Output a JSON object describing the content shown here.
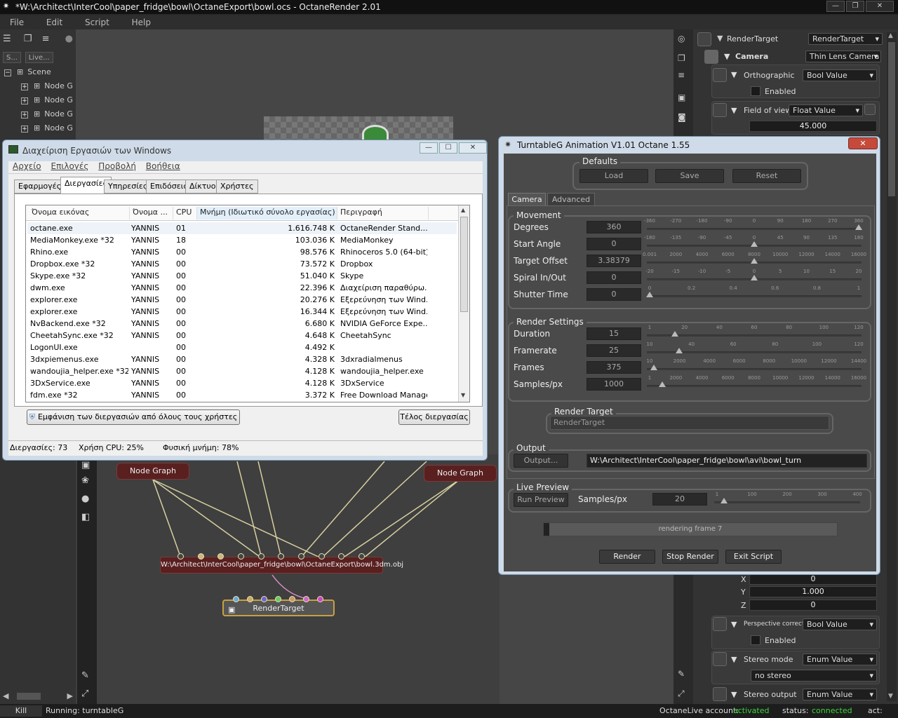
{
  "app": {
    "title": "*W:\\Architect\\InterCool\\paper_fridge\\bowl\\OctaneExport\\bowl.ocs - OctaneRender 2.01",
    "menu": [
      "File",
      "Edit",
      "Script",
      "Help"
    ]
  },
  "left": {
    "tabs": [
      "S...",
      "Live..."
    ],
    "scene_label": "Scene",
    "tree_items": [
      "Node G",
      "Node G",
      "Node G",
      "Node G"
    ]
  },
  "graph": {
    "node1": "Node Graph",
    "node2": "Node Graph",
    "obj_node": "W:\\Architect\\InterCool\\paper_fridge\\bowl\\OctaneExport\\bowl.3dm.obj",
    "rt_node": "RenderTarget"
  },
  "right": {
    "rendertarget_label": "RenderTarget",
    "rendertarget_dd": "RenderTarget",
    "camera_label": "Camera",
    "camera_dd": "Thin Lens Camera",
    "ortho_label": "Orthographic",
    "ortho_dd": "Bool Value",
    "ortho_enabled": "Enabled",
    "fov_label": "Field of view",
    "fov_dd": "Float Value",
    "fov_value": "45.000",
    "x_label": "X",
    "x_value": "0",
    "y_label": "Y",
    "y_value": "1.000",
    "z_label": "Z",
    "z_value": "0",
    "persp_label": "Perspective correction",
    "persp_dd": "Bool Value",
    "persp_enabled": "Enabled",
    "stereo_mode_label": "Stereo mode",
    "stereo_mode_dd": "Enum Value",
    "stereo_mode_value": "no stereo",
    "stereo_out_label": "Stereo output",
    "stereo_out_dd": "Enum Value"
  },
  "status": {
    "kill": "Kill",
    "running": "Running: turntableG",
    "live_label": "OctaneLive account:",
    "live_value": "activated",
    "status_label": "status:",
    "status_value": "connected",
    "act_label": "act:"
  },
  "taskmgr": {
    "title": "Διαχείριση Εργασιών των Windows",
    "menu": [
      "Αρχείο",
      "Επιλογές",
      "Προβολή",
      "Βοήθεια"
    ],
    "tabs": [
      "Εφαρμογές",
      "Διεργασίες",
      "Υπηρεσίες",
      "Επιδόσεις",
      "Δίκτυο",
      "Χρήστες"
    ],
    "columns": [
      "Όνομα εικόνας",
      "Όνομα ...",
      "CPU",
      "Μνήμη (Ιδιωτικό σύνολο εργασίας)",
      "Περιγραφή"
    ],
    "rows": [
      [
        "octane.exe",
        "YANNIS",
        "01",
        "1.616.748 K",
        "OctaneRender Stand..."
      ],
      [
        "MediaMonkey.exe *32",
        "YANNIS",
        "18",
        "103.036 K",
        "MediaMonkey"
      ],
      [
        "Rhino.exe",
        "YANNIS",
        "00",
        "98.576 K",
        "Rhinoceros 5.0 (64-bit)"
      ],
      [
        "Dropbox.exe *32",
        "YANNIS",
        "00",
        "73.572 K",
        "Dropbox"
      ],
      [
        "Skype.exe *32",
        "YANNIS",
        "00",
        "51.040 K",
        "Skype"
      ],
      [
        "dwm.exe",
        "YANNIS",
        "00",
        "22.396 K",
        "Διαχείριση παραθύρω..."
      ],
      [
        "explorer.exe",
        "YANNIS",
        "00",
        "20.276 K",
        "Εξερεύνηση των Wind..."
      ],
      [
        "explorer.exe",
        "YANNIS",
        "00",
        "16.344 K",
        "Εξερεύνηση των Wind..."
      ],
      [
        "NvBackend.exe *32",
        "YANNIS",
        "00",
        "6.680 K",
        "NVIDIA GeForce Expe..."
      ],
      [
        "CheetahSync.exe *32",
        "YANNIS",
        "00",
        "4.648 K",
        "CheetahSync"
      ],
      [
        "LogonUI.exe",
        "",
        "00",
        "4.492 K",
        ""
      ],
      [
        "3dxpiemenus.exe",
        "YANNIS",
        "00",
        "4.328 K",
        "3dxradialmenus"
      ],
      [
        "wandoujia_helper.exe *32",
        "YANNIS",
        "00",
        "4.128 K",
        "wandoujia_helper.exe"
      ],
      [
        "3DxService.exe",
        "YANNIS",
        "00",
        "4.128 K",
        "3DxService"
      ],
      [
        "fdm.exe *32",
        "YANNIS",
        "00",
        "3.372 K",
        "Free Download Manager"
      ]
    ],
    "show_all": "Εμφάνιση των διεργασιών από όλους τους χρήστες",
    "end_process": "Τέλος διεργασίας",
    "procs": "Διεργασίες: 73",
    "cpu": "Χρήση CPU: 25%",
    "mem": "Φυσική μνήμη: 78%"
  },
  "turntable": {
    "title": "TurntableG Animation V1.01 Octane 1.55",
    "defaults": "Defaults",
    "load": "Load",
    "save": "Save",
    "reset": "Reset",
    "tab_camera": "Camera",
    "tab_advanced": "Advanced",
    "movement": "Movement",
    "move_rows": [
      {
        "label": "Degrees",
        "value": "360",
        "ticks": [
          "-360",
          "-270",
          "-180",
          "-90",
          "0",
          "90",
          "180",
          "270",
          "360"
        ],
        "pos": 1.0
      },
      {
        "label": "Start Angle",
        "value": "0",
        "ticks": [
          "-180",
          "-135",
          "-90",
          "-45",
          "0",
          "45",
          "90",
          "135",
          "180"
        ],
        "pos": 0.5
      },
      {
        "label": "Target Offset",
        "value": "3.38379",
        "ticks": [
          "0.001",
          "2000",
          "4000",
          "6000",
          "8000",
          "10000",
          "12000",
          "14000",
          "16000"
        ],
        "pos": 0.5
      },
      {
        "label": "Spiral In/Out",
        "value": "0",
        "ticks": [
          "-20",
          "-15",
          "-10",
          "-5",
          "0",
          "5",
          "10",
          "15",
          "20"
        ],
        "pos": 0.5
      },
      {
        "label": "Shutter Time",
        "value": "0",
        "ticks": [
          "0",
          "0.2",
          "0.4",
          "0.6",
          "0.8",
          "1"
        ],
        "pos": 0.0
      }
    ],
    "render_settings": "Render Settings",
    "render_rows": [
      {
        "label": "Duration",
        "value": "15",
        "ticks": [
          "1",
          "20",
          "40",
          "60",
          "80",
          "100",
          "120"
        ],
        "pos": 0.12
      },
      {
        "label": "Framerate",
        "value": "25",
        "ticks": [
          "10",
          "40",
          "60",
          "80",
          "100",
          "120"
        ],
        "pos": 0.14
      },
      {
        "label": "Frames",
        "value": "375",
        "ticks": [
          "10",
          "2000",
          "4000",
          "6000",
          "8000",
          "10000",
          "12000",
          "14400"
        ],
        "pos": 0.02
      },
      {
        "label": "Samples/px",
        "value": "1000",
        "ticks": [
          "1",
          "2000",
          "4000",
          "6000",
          "8000",
          "10000",
          "12000",
          "14000",
          "16000"
        ],
        "pos": 0.06
      }
    ],
    "render_target": "Render Target",
    "render_target_value": "RenderTarget",
    "output": "Output",
    "output_btn": "Output...",
    "output_path": "W:\\Architect\\InterCool\\paper_fridge\\bowl\\avi\\bowl_turn",
    "live_preview": "Live Preview",
    "run_preview": "Run Preview",
    "samples_label": "Samples/px",
    "samples_value": "20",
    "preview_ticks": [
      "1",
      "100",
      "200",
      "300",
      "400"
    ],
    "preview_pos": 0.05,
    "progress_text": "rendering frame 7",
    "progress": 0.02,
    "render": "Render",
    "stop_render": "Stop Render",
    "exit_script": "Exit Script"
  }
}
